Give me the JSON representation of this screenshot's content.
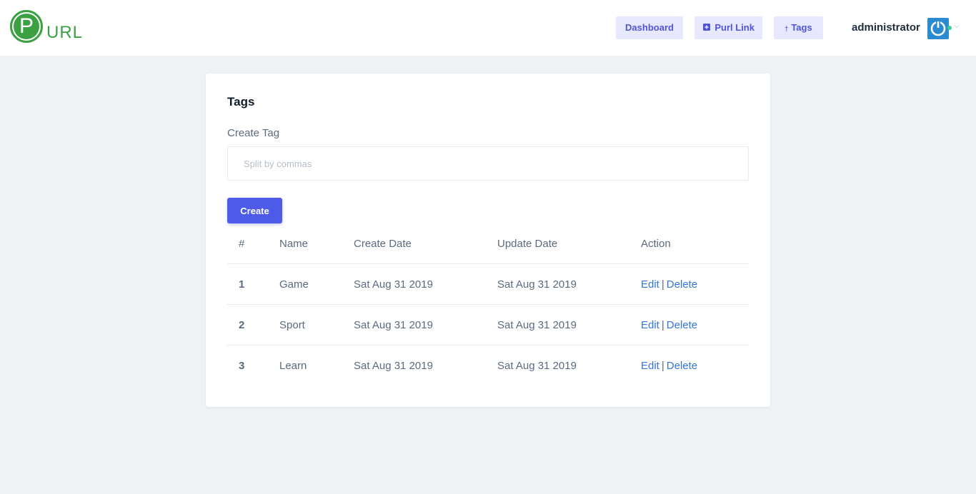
{
  "app": {
    "logo_letter": "P",
    "logo_text": "URL",
    "brand_color": "#3aa042"
  },
  "nav": {
    "dashboard": "Dashboard",
    "purl_link": "Purl Link",
    "tags": "Tags"
  },
  "user": {
    "name": "administrator"
  },
  "page": {
    "title": "Tags",
    "create_label": "Create Tag",
    "input_placeholder": "Split by commas",
    "input_value": "",
    "create_button": "Create"
  },
  "table": {
    "headers": [
      "#",
      "Name",
      "Create Date",
      "Update Date",
      "Action"
    ],
    "rows": [
      {
        "num": "1",
        "name": "Game",
        "created": "Sat Aug 31 2019",
        "updated": "Sat Aug 31 2019",
        "edit": "Edit",
        "sep": "|",
        "delete": "Delete"
      },
      {
        "num": "2",
        "name": "Sport",
        "created": "Sat Aug 31 2019",
        "updated": "Sat Aug 31 2019",
        "edit": "Edit",
        "sep": "|",
        "delete": "Delete"
      },
      {
        "num": "3",
        "name": "Learn",
        "created": "Sat Aug 31 2019",
        "updated": "Sat Aug 31 2019",
        "edit": "Edit",
        "sep": "|",
        "delete": "Delete"
      }
    ]
  },
  "icons": {
    "logo": "purl-logo-icon",
    "purl_link": "add-link-icon",
    "tags": "tag-icon",
    "avatar": "power-icon",
    "dropdown": "chevron-down-icon"
  },
  "colors": {
    "accent": "#4e5be8",
    "nav_bg": "#e7e8fd",
    "link": "#3476d8",
    "background": "#eff2f5"
  }
}
